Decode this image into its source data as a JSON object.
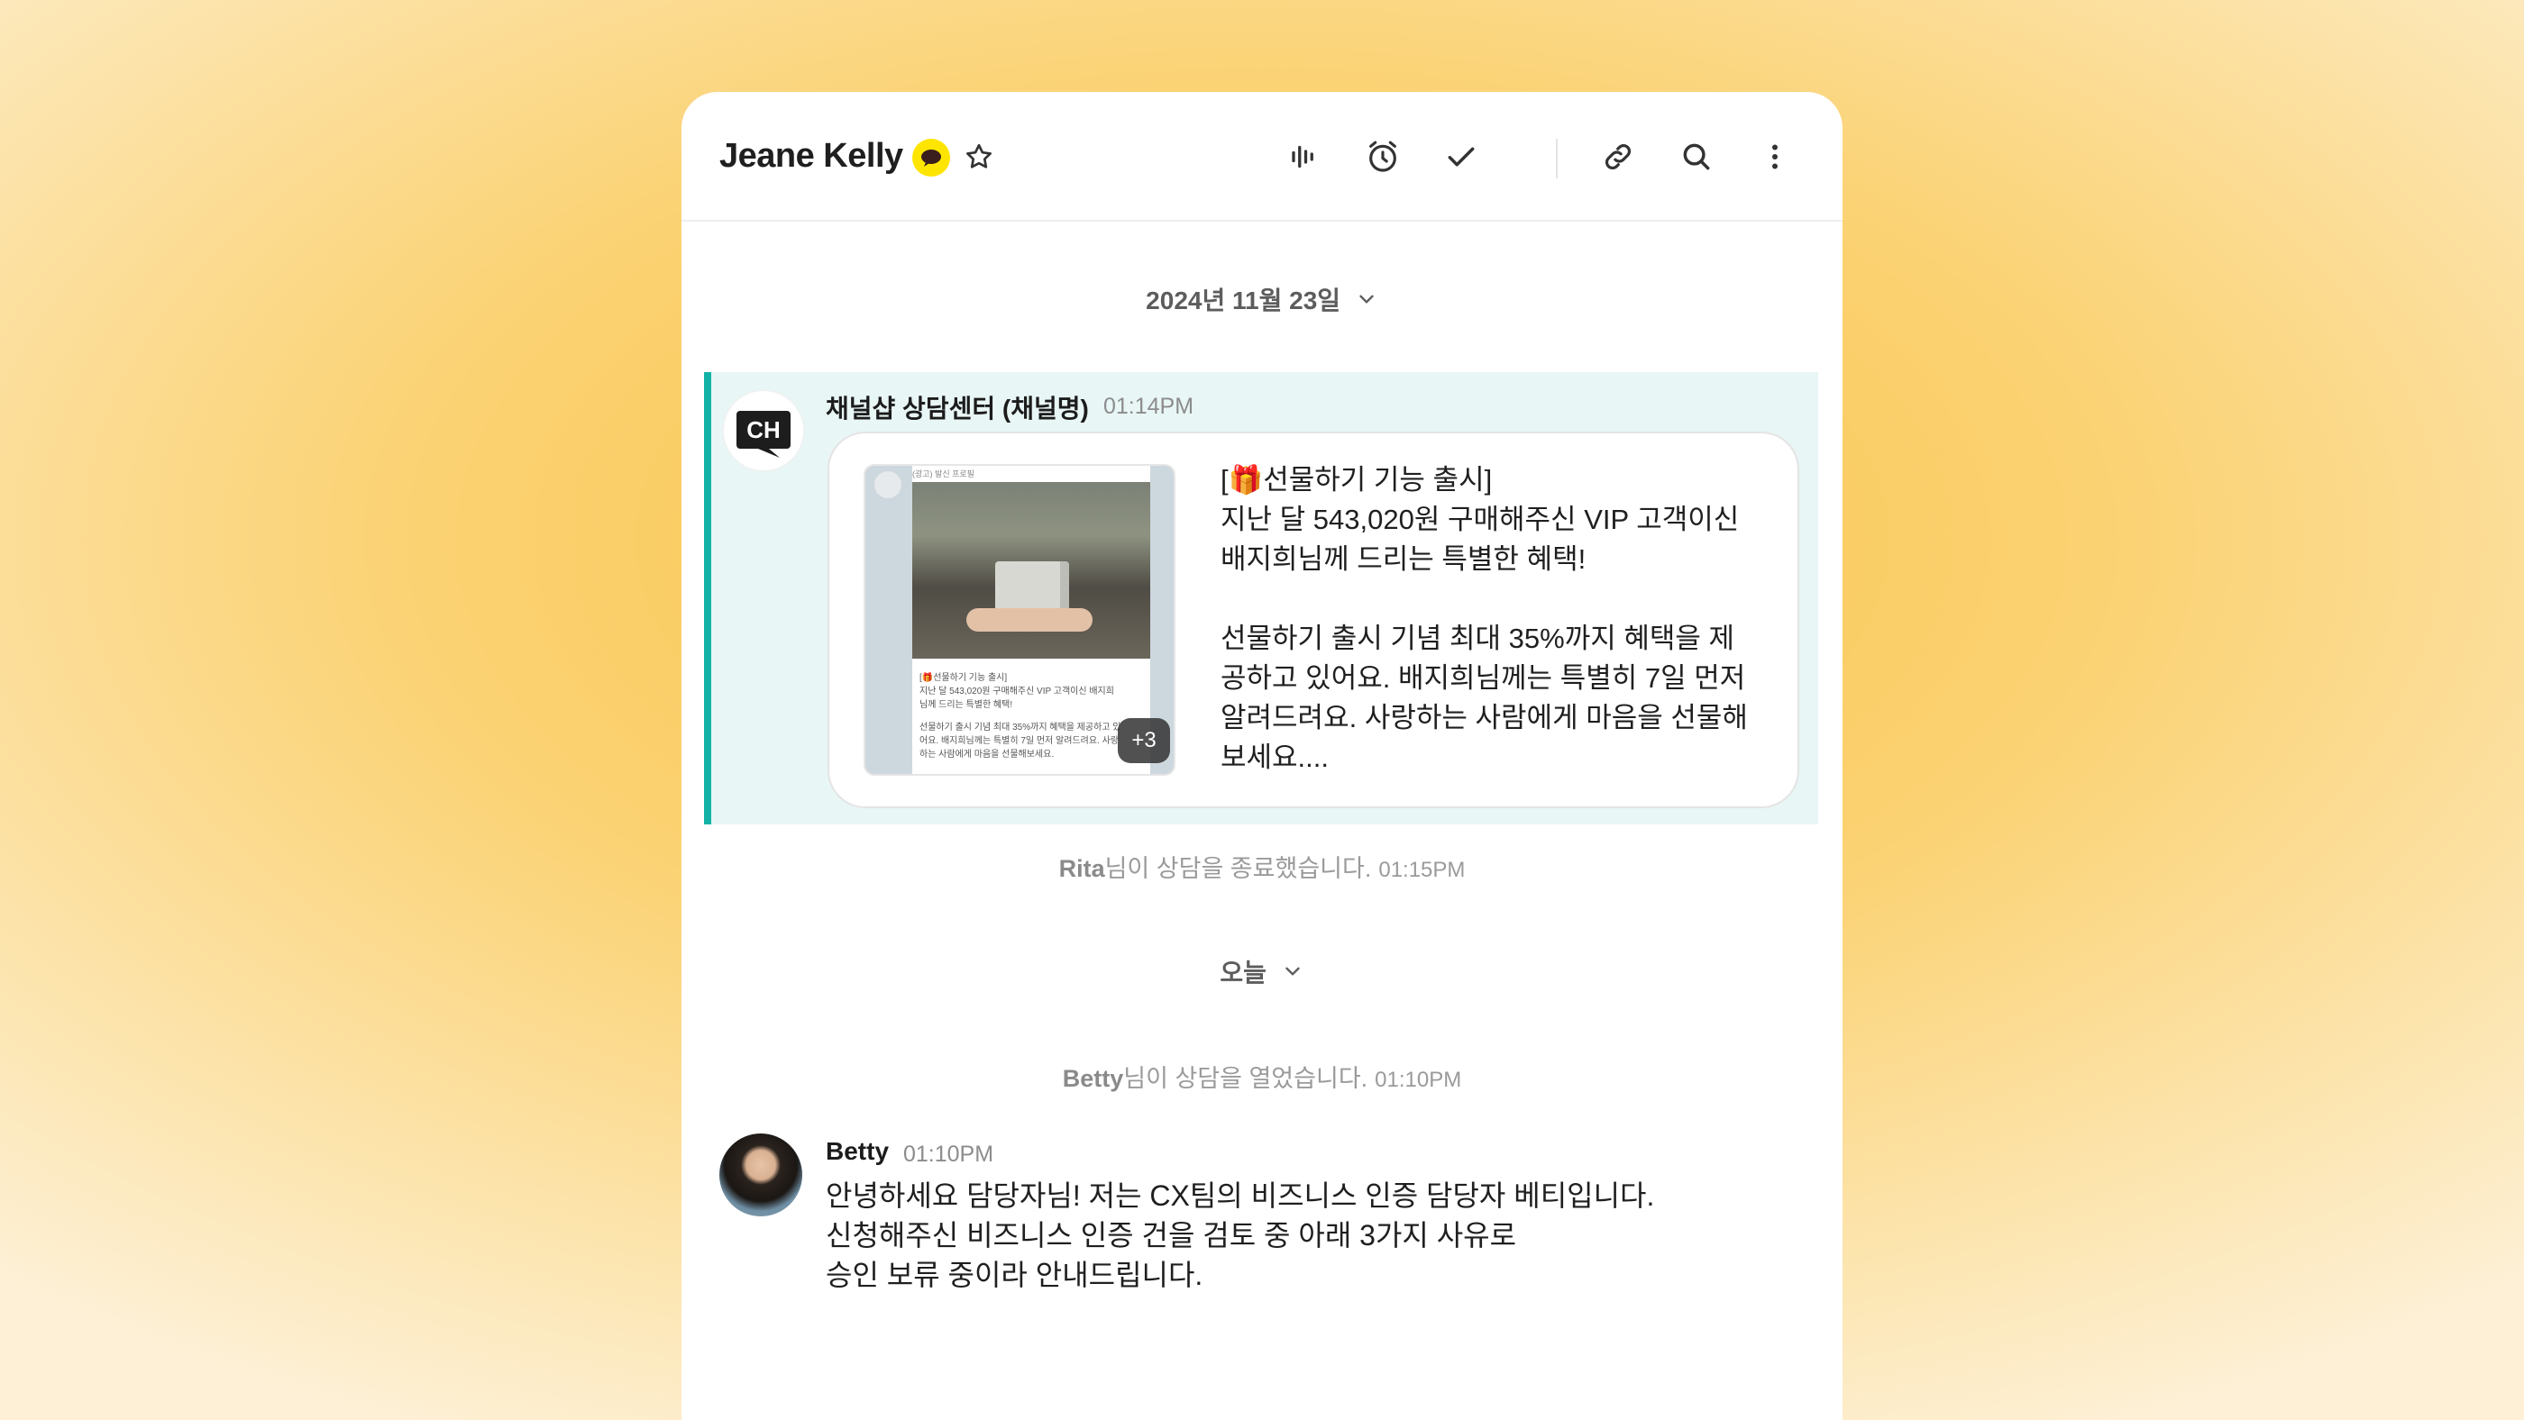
{
  "header": {
    "contact_name": "Jeane Kelly",
    "icons": [
      "kakao-chat-icon",
      "star-icon",
      "voice-wave-icon",
      "alarm-clock-icon",
      "check-icon",
      "link-icon",
      "search-icon",
      "more-vertical-icon"
    ]
  },
  "colors": {
    "accent": "#13b2a6",
    "highlight_bg": "#e8f6f5",
    "kakao_yellow": "#fee500"
  },
  "date_separators": [
    "2024년 11월 23일",
    "오늘"
  ],
  "messages": [
    {
      "sender": "채널샵 상담센터 (채널명)",
      "time": "01:14PM",
      "avatar": "CH",
      "card": {
        "thumb_label": "(광고) 발신 프로필",
        "thumb_lines": [
          "[🎁선물하기 기능 출시]",
          "지난 달 543,020원 구매해주신 VIP 고객이신 배지희",
          "님께 드리는 특별한 혜택!",
          "선물하기 출시 기념 최대 35%까지 혜택을 제공하고 있",
          "어요. 배지희님께는 특별히 7일 먼저 알려드려요. 사랑",
          "하는 사람에게 마음을 선물해보세요."
        ],
        "extra_count": "+3",
        "lines": [
          "[🎁선물하기 기능 출시]",
          "지난 달 543,020원 구매해주신 VIP 고객이신",
          "배지희님께 드리는 특별한 혜택!"
        ],
        "lines2": [
          "선물하기 출시 기념 최대 35%까지 혜택을 제",
          "공하고 있어요. 배지희님께는 특별히 7일 먼저",
          "알려드려요. 사랑하는 사람에게 마음을 선물해",
          "보세요...."
        ]
      }
    },
    {
      "sender": "Betty",
      "time": "01:10PM",
      "lines": [
        "안녕하세요 담당자님! 저는 CX팀의 비즈니스 인증 담당자 베티입니다.",
        "신청해주신 비즈니스 인증 건을 검토 중 아래 3가지 사유로",
        "승인 보류 중이라 안내드립니다."
      ]
    }
  ],
  "system_messages": [
    {
      "name": "Rita",
      "text": "님이 상담을 종료했습니다.",
      "time": "01:15PM"
    },
    {
      "name": "Betty",
      "text": "님이 상담을 열었습니다.",
      "time": "01:10PM"
    }
  ]
}
